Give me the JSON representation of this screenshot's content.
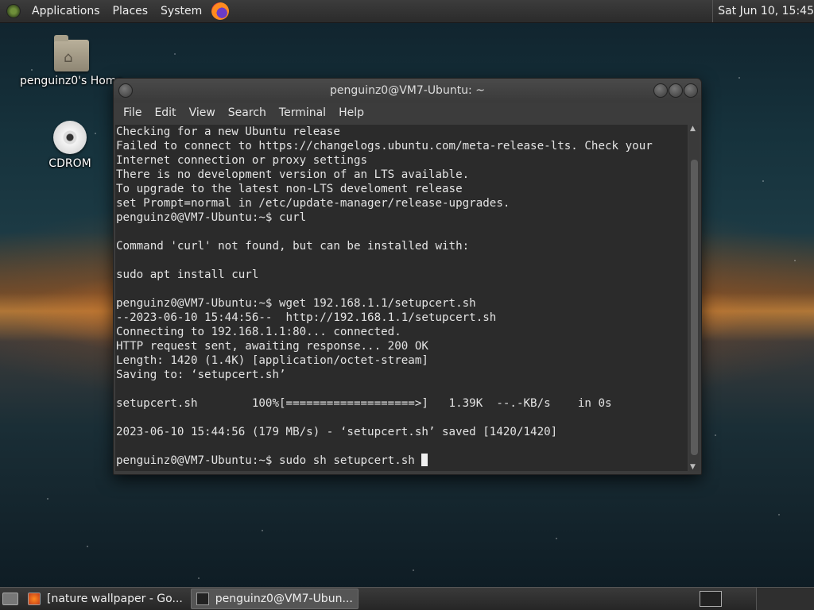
{
  "top_panel": {
    "menus": [
      "Applications",
      "Places",
      "System"
    ],
    "clock": "Sat Jun 10, 15:45"
  },
  "desktop": {
    "home_label": "penguinz0's Home",
    "cdrom_label": "CDROM"
  },
  "terminal": {
    "title": "penguinz0@VM7-Ubuntu: ~",
    "menu": [
      "File",
      "Edit",
      "View",
      "Search",
      "Terminal",
      "Help"
    ],
    "lines": [
      "Checking for a new Ubuntu release",
      "Failed to connect to https://changelogs.ubuntu.com/meta-release-lts. Check your",
      "Internet connection or proxy settings",
      "There is no development version of an LTS available.",
      "To upgrade to the latest non-LTS develoment release",
      "set Prompt=normal in /etc/update-manager/release-upgrades.",
      "penguinz0@VM7-Ubuntu:~$ curl",
      "",
      "Command 'curl' not found, but can be installed with:",
      "",
      "sudo apt install curl",
      "",
      "penguinz0@VM7-Ubuntu:~$ wget 192.168.1.1/setupcert.sh",
      "--2023-06-10 15:44:56--  http://192.168.1.1/setupcert.sh",
      "Connecting to 192.168.1.1:80... connected.",
      "HTTP request sent, awaiting response... 200 OK",
      "Length: 1420 (1.4K) [application/octet-stream]",
      "Saving to: ‘setupcert.sh’",
      "",
      "setupcert.sh        100%[===================>]   1.39K  --.-KB/s    in 0s",
      "",
      "2023-06-10 15:44:56 (179 MB/s) - ‘setupcert.sh’ saved [1420/1420]",
      ""
    ],
    "prompt_line": "penguinz0@VM7-Ubuntu:~$ sudo sh setupcert.sh "
  },
  "taskbar": {
    "tasks": [
      "[nature wallpaper - Go...",
      "penguinz0@VM7-Ubun..."
    ]
  }
}
